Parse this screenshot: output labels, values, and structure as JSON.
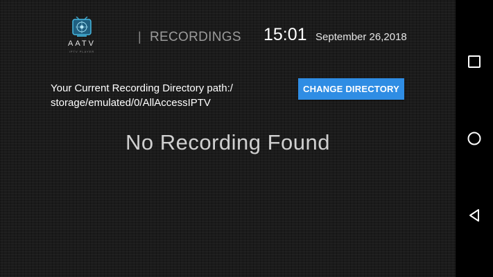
{
  "header": {
    "logo": {
      "name": "AATV",
      "subtitle": "IPTV PLAYER"
    },
    "separator": "|",
    "title": "RECORDINGS",
    "time": "15:01",
    "date": "September 26,2018"
  },
  "main": {
    "path_label_line1": "Your Current Recording Directory path:/",
    "path_label_line2": "storage/emulated/0/AllAccessIPTV",
    "change_button_label": "CHANGE DIRECTORY",
    "empty_message": "No Recording Found"
  },
  "navbar": {
    "buttons": [
      "recents-icon",
      "home-icon",
      "back-icon"
    ]
  },
  "colors": {
    "accent": "#2f8de4",
    "background": "#1b1b1b",
    "navbar": "#000000"
  }
}
